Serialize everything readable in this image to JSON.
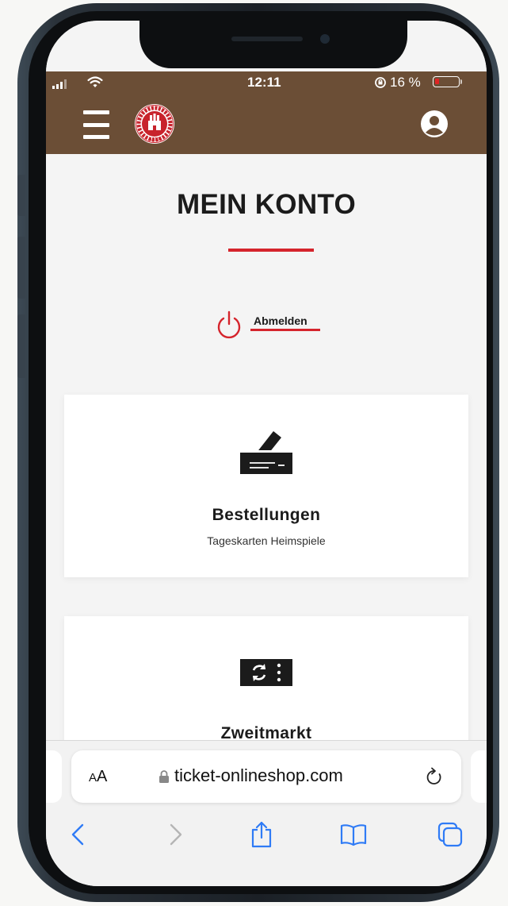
{
  "status_bar": {
    "time": "12:11",
    "battery": "16 %",
    "battery_level_percent": 16
  },
  "header": {
    "logo": {
      "name": "club-logo",
      "text": "FC ST. PAULI",
      "year": "1910"
    },
    "menu_icon": "hamburger-icon",
    "account_icon": "user-account-icon"
  },
  "page": {
    "title": "MEIN KONTO",
    "logout_label": "Abmelden"
  },
  "cards": [
    {
      "title": "Bestellungen",
      "subtitle": "Tageskarten Heimspiele",
      "icon": "ticket-order-icon"
    },
    {
      "title": "Zweitmarkt",
      "icon": "ticket-resale-icon"
    }
  ],
  "browser": {
    "text_size_label_small": "A",
    "text_size_label_large": "A",
    "url": "ticket-onlineshop.com",
    "toolbar": [
      "back-icon",
      "forward-icon",
      "share-icon",
      "bookmarks-icon",
      "tabs-icon"
    ]
  },
  "colors": {
    "header_brown": "#6b4e36",
    "accent_red": "#d5242c",
    "ios_blue": "#2f7bf6"
  }
}
